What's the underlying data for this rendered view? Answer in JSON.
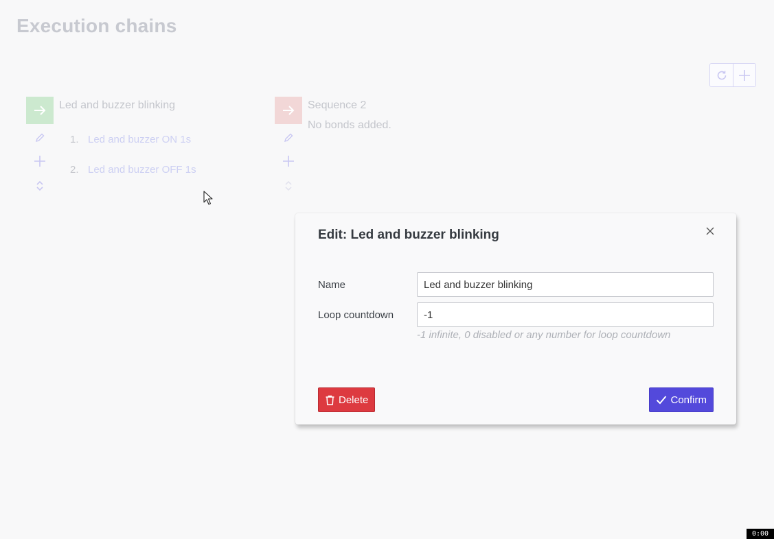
{
  "page": {
    "title": "Execution chains"
  },
  "toolbar": {
    "refresh_icon": "refresh-icon",
    "add_icon": "plus-icon"
  },
  "chains": [
    {
      "name": "Led and buzzer blinking",
      "play_color": "#cce9cf",
      "bonds": [
        {
          "number": "1.",
          "label": "Led and buzzer ON 1s"
        },
        {
          "number": "2.",
          "label": "Led and buzzer OFF 1s"
        }
      ]
    },
    {
      "name": "Sequence 2",
      "play_color": "#f2d7d7",
      "empty_text": "No bonds added."
    }
  ],
  "modal": {
    "title": "Edit: Led and buzzer blinking",
    "name_label": "Name",
    "name_value": "Led and buzzer blinking",
    "loop_label": "Loop countdown",
    "loop_value": "-1",
    "loop_hint": "-1 infinite, 0 disabled or any number for loop countdown",
    "delete_label": "Delete",
    "confirm_label": "Confirm"
  },
  "recording_timer": "0:00",
  "colors": {
    "delete": "#dd3a40",
    "confirm": "#5349db",
    "accent": "#5349db"
  }
}
